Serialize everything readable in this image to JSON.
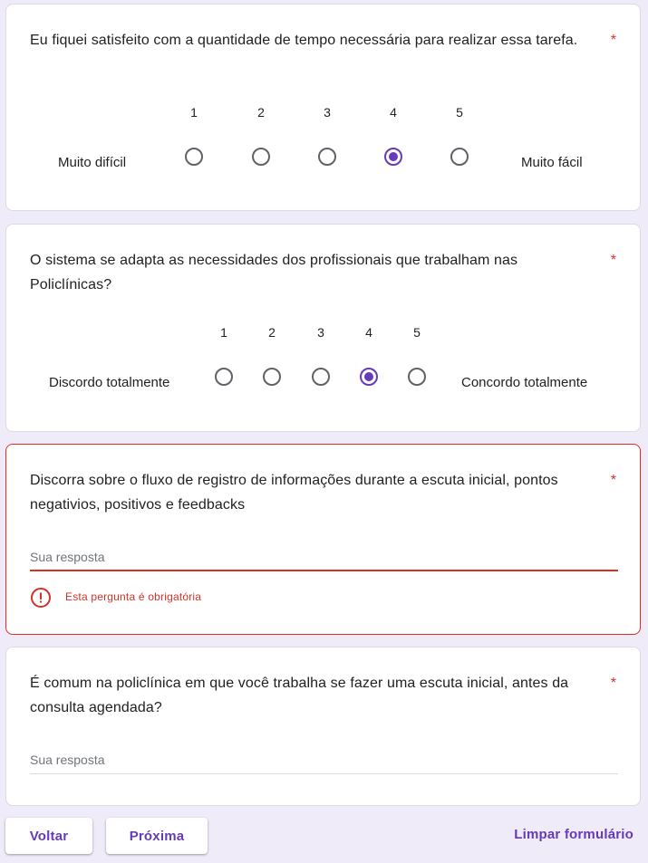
{
  "questions": [
    {
      "title": "Eu fiquei satisfeito com a quantidade de tempo necessária para realizar essa tarefa.",
      "required_mark": "*",
      "scale": [
        "1",
        "2",
        "3",
        "4",
        "5"
      ],
      "low_label": "Muito difícil",
      "high_label": "Muito fácil",
      "selected": "4"
    },
    {
      "title": "O sistema se adapta as necessidades dos profissionais que trabalham nas Policlínicas?",
      "required_mark": "*",
      "scale": [
        "1",
        "2",
        "3",
        "4",
        "5"
      ],
      "low_label": "Discordo totalmente",
      "high_label": "Concordo totalmente",
      "selected": "4"
    },
    {
      "title": "Discorra sobre o fluxo de registro de informações durante a escuta inicial, pontos negativios, positivos e feedbacks",
      "required_mark": "*",
      "placeholder": "Sua resposta",
      "value": "",
      "error": "Esta pergunta é obrigatória"
    },
    {
      "title": "É comum na policlínica em que você trabalha se fazer uma escuta inicial, antes da consulta agendada?",
      "required_mark": "*",
      "placeholder": "Sua resposta",
      "value": ""
    }
  ],
  "footer": {
    "back_label": "Voltar",
    "next_label": "Próxima",
    "clear_label": "Limpar formulário"
  },
  "colors": {
    "accent": "#673ab7",
    "error": "#d93025",
    "background": "#f0ebf8"
  }
}
